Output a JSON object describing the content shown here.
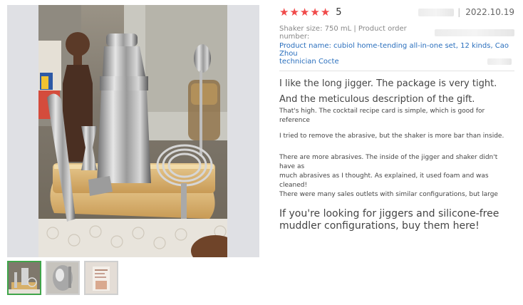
{
  "gallery": {
    "thumbnails": [
      "photo-1",
      "photo-2",
      "photo-3"
    ],
    "active_index": 0
  },
  "review": {
    "stars": 5,
    "rating_label": "5",
    "date": "2022.10.19",
    "shaker_size": "Shaker size: 750 mL | Product order number:",
    "product_name_line1": "Product name: cubiol home-tending all-in-one set, 12 kinds, Cao Zhou",
    "product_name_line2": "technician Cocte",
    "paragraphs": {
      "p1": "I like the long jigger. The package is very tight.",
      "p2": "And the meticulous description of the gift.",
      "p3": "That's high. The cocktail recipe card is simple, which is good for reference",
      "p4": "I tried to remove the abrasive, but the shaker is more bar than inside.",
      "p5a": "There are more abrasives. The inside of the jigger and shaker didn't have as",
      "p5b": "much abrasives as I thought. As explained, it used foam and was cleaned!",
      "p5c": "There were many sales outlets with similar configurations, but large",
      "p6a": "If you're looking for jiggers and silicone-free",
      "p6b": "muddler configurations, buy them here!"
    }
  },
  "colors": {
    "star": "#f04a4a",
    "link": "#2a6fbd",
    "thumb_active_border": "#3fa54a"
  }
}
